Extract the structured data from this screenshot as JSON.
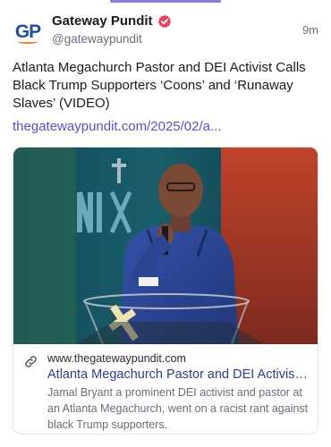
{
  "post": {
    "author_name": "Gateway Pundit",
    "author_handle": "@gatewaypundit",
    "avatar_text": "GP",
    "timestamp": "9m",
    "text": "Atlanta Megachurch Pastor and DEI Activist Calls Black Trump Supporters ‘Coons’ and ‘Runaway Slaves’ (VIDEO)",
    "link": "thegatewaypundit.com/2025/02/a..."
  },
  "card": {
    "image_icon": "video-thumbnail-pastor-preaching",
    "domain": "www.thegatewaypundit.com",
    "title": "Atlanta Megachurch Pastor and DEI Activist Calls Black Trump Supporters ‘Coons’ and ‘Runaway Slaves’ (VIDEO)",
    "description": "Jamal Bryant a prominent DEI activist and pastor at an Atlanta Megachurch, went on a racist rant against black Trump supporters."
  },
  "colors": {
    "accent": "#5b4fc6",
    "verified": "#e3445f",
    "brand_blue": "#1f4f9c",
    "brand_orange": "#e0823a"
  }
}
